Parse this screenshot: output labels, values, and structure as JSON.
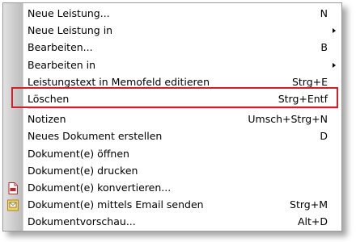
{
  "menu": {
    "items": [
      {
        "label": "Neue Leistung...",
        "shortcut": "N",
        "submenu": false
      },
      {
        "label": "Neue Leistung in",
        "shortcut": "",
        "submenu": true
      },
      {
        "label": "Bearbeiten...",
        "shortcut": "B",
        "submenu": false
      },
      {
        "label": "Bearbeiten in",
        "shortcut": "",
        "submenu": true
      },
      {
        "label": "Leistungstext in Memofeld editieren",
        "shortcut": "Strg+E",
        "submenu": false
      },
      {
        "label": "Löschen",
        "shortcut": "Strg+Entf",
        "submenu": false,
        "highlighted": true
      },
      {
        "label": "Notizen",
        "shortcut": "Umsch+Strg+N",
        "submenu": false
      },
      {
        "label": "Neues Dokument erstellen",
        "shortcut": "D",
        "submenu": false
      },
      {
        "label": "Dokument(e) öffnen",
        "shortcut": "",
        "submenu": false
      },
      {
        "label": "Dokument(e) drucken",
        "shortcut": "",
        "submenu": false
      },
      {
        "label": "Dokument(e) konvertieren...",
        "shortcut": "",
        "submenu": false,
        "icon": "pdf-icon"
      },
      {
        "label": "Dokument(e) mittels Email senden",
        "shortcut": "Strg+M",
        "submenu": false,
        "icon": "mail-icon"
      },
      {
        "label": "Dokumentvorschau...",
        "shortcut": "Alt+D",
        "submenu": false
      }
    ]
  },
  "colors": {
    "highlight_border": "#d0202a",
    "gutter": "#c8c8c8"
  }
}
